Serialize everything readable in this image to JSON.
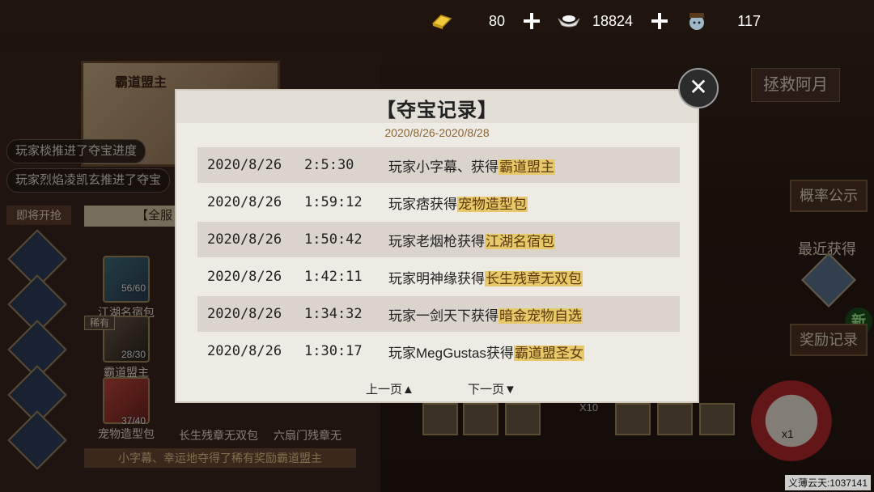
{
  "currency": [
    {
      "icon": "gold-ingot-icon",
      "value": "80"
    },
    {
      "icon": "silver-ingot-icon",
      "value": "18824"
    },
    {
      "icon": "avatar-token-icon",
      "value": "117"
    }
  ],
  "left": {
    "notices": [
      "玩家棪推进了夺宝进度",
      "玩家烈焰凌凯玄推进了夺宝"
    ],
    "soon_label": "即将开抢",
    "quan_label": "【全服",
    "items": [
      {
        "name": "江湖名宿包",
        "count": "56/60"
      },
      {
        "name": "霸道盟主",
        "count": "28/30",
        "badge": "稀有"
      },
      {
        "name": "宠物造型包",
        "count": "37/40"
      },
      {
        "name": "长生残章无双包"
      },
      {
        "name": "六扇门残章无"
      }
    ],
    "bottom_message": "小字幕、幸运地夺得了稀有奖励霸道盟主"
  },
  "right": {
    "rescue": "拯救阿月",
    "probability": "概率公示",
    "recent": "最近获得",
    "new_badge": "新",
    "reward_record": "奖励记录",
    "drum_label": "x1",
    "x10": "X10"
  },
  "modal": {
    "title": "【夺宝记录】",
    "range": "2020/8/26-2020/8/28",
    "records": [
      {
        "date": "2020/8/26",
        "time": "2:5:30",
        "text": "玩家小字幕、获得",
        "prize": "霸道盟主"
      },
      {
        "date": "2020/8/26",
        "time": "1:59:12",
        "text": "玩家痞获得",
        "prize": "宠物造型包"
      },
      {
        "date": "2020/8/26",
        "time": "1:50:42",
        "text": "玩家老烟枪获得",
        "prize": "江湖名宿包"
      },
      {
        "date": "2020/8/26",
        "time": "1:42:11",
        "text": "玩家明神缘获得",
        "prize": "长生残章无双包"
      },
      {
        "date": "2020/8/26",
        "time": "1:34:32",
        "text": "玩家一剑天下获得",
        "prize": "暗金宠物自选"
      },
      {
        "date": "2020/8/26",
        "time": "1:30:17",
        "text": "玩家MegGustas获得",
        "prize": "霸道盟圣女"
      }
    ],
    "prev": "上一页▲",
    "next": "下一页▼",
    "close_glyph": "✕"
  },
  "footer": "义薄云天:1037141"
}
